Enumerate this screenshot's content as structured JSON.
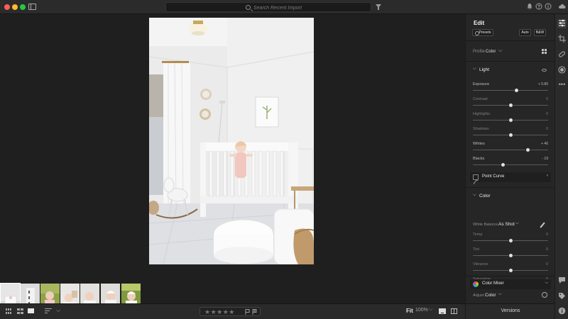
{
  "app": {
    "search_placeholder": "Search Recent Import"
  },
  "titlebar": {
    "right_icons": [
      "bell-icon",
      "help-icon",
      "info-icon"
    ]
  },
  "bottombar": {
    "view_icons": [
      "grid-view-icon",
      "square-grid-view-icon",
      "detail-view-icon"
    ],
    "sort_icon": "sort-icon",
    "stars": "★★★★★",
    "fit_label": "Fit",
    "zoom_value": "100%",
    "chevron": "⌵"
  },
  "panel": {
    "title": "Edit",
    "presets_label": "Presets",
    "auto_label": "Auto",
    "bw_label": "B&W",
    "profile_label": "Profile",
    "profile_value": "Color",
    "chevron": "⌵",
    "light": {
      "title": "Light",
      "sliders": [
        {
          "label": "Exposure",
          "value": "+ 0.80",
          "position": 0.58,
          "dim": false
        },
        {
          "label": "Contrast",
          "value": "0",
          "position": 0.5,
          "dim": true
        },
        {
          "label": "Highlights",
          "value": "0",
          "position": 0.5,
          "dim": true
        },
        {
          "label": "Shadows",
          "value": "0",
          "position": 0.5,
          "dim": true
        },
        {
          "label": "Whites",
          "value": "+ 46",
          "position": 0.73,
          "dim": false
        },
        {
          "label": "Blacks",
          "value": "- 19",
          "position": 0.4,
          "dim": false
        }
      ],
      "point_curve_label": "Point Curve"
    },
    "color": {
      "title": "Color",
      "wb_label": "White Balance",
      "wb_value": "As Shot",
      "sliders": [
        {
          "label": "Temp",
          "value": "0",
          "position": 0.5,
          "dim": true
        },
        {
          "label": "Tint",
          "value": "0",
          "position": 0.5,
          "dim": true
        },
        {
          "label": "Vibrance",
          "value": "0",
          "position": 0.5,
          "dim": true
        },
        {
          "label": "Saturation",
          "value": "0",
          "position": 0.5,
          "dim": true
        }
      ],
      "mixer_label": "Color Mixer",
      "adjust_label": "Adjust",
      "adjust_value": "Color"
    },
    "versions_label": "Versions"
  },
  "rail": {
    "icons": [
      "sliders-icon",
      "crop-icon",
      "healing-icon",
      "mask-icon",
      "more-icon"
    ],
    "bottom_icons": [
      "comment-icon",
      "tag-icon",
      "info-icon"
    ]
  },
  "filmstrip": {
    "count": 7,
    "selected_index": 0
  }
}
